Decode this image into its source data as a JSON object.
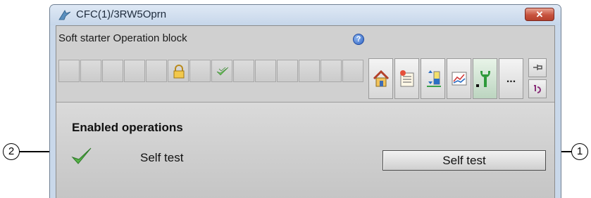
{
  "window": {
    "title": "CFC(1)/3RW5Oprn",
    "close_label": "✕"
  },
  "faceplate": {
    "block_name": "Soft starter Operation block",
    "help_label": "?",
    "status_cells": [
      "empty",
      "empty",
      "empty",
      "empty",
      "empty",
      "lock",
      "empty",
      "checked",
      "empty",
      "empty",
      "empty",
      "empty",
      "empty",
      "empty"
    ],
    "toolbar_icons": [
      "home-icon",
      "message-list-icon",
      "parameter-icon",
      "trend-icon",
      "maintenance-icon",
      "more-icon"
    ],
    "toolbar_active": "maintenance-icon",
    "more_label": "..."
  },
  "content": {
    "section_title": "Enabled operations",
    "operations": [
      {
        "label": "Self test",
        "button_label": "Self test",
        "enabled": true
      }
    ]
  },
  "callouts": {
    "button": "1",
    "status": "2"
  }
}
